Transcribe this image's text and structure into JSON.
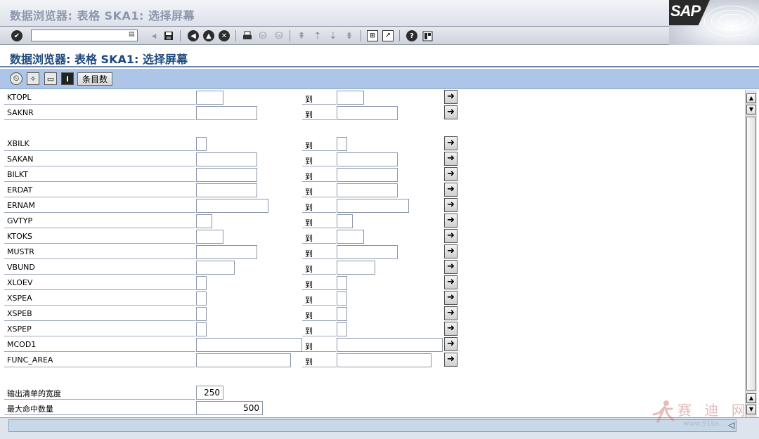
{
  "window": {
    "title": "数据浏览器: 表格 SKA1: 选择屏幕"
  },
  "brand": {
    "logo_text": "SAP",
    "colors": {
      "screen_title": "#1e4a7e",
      "app_toolbar": "#adc5e6",
      "header_bg": "#dde1ea"
    }
  },
  "toolbar": {
    "command_field": {
      "value": "",
      "placeholder": ""
    },
    "icons": [
      "enter-checkmark-icon",
      "command-history-icon",
      "save-icon",
      "back-icon",
      "exit-icon",
      "cancel-icon",
      "print-icon",
      "find-icon",
      "find-next-icon",
      "first-page-icon",
      "previous-page-icon",
      "next-page-icon",
      "last-page-icon",
      "create-session-icon",
      "create-shortcut-icon",
      "help-icon",
      "customize-layout-icon"
    ]
  },
  "screen": {
    "title": "数据浏览器: 表格 SKA1: 选择屏幕"
  },
  "app_toolbar": {
    "entries_label": "条目数",
    "icons": [
      "execute-icon",
      "get-variant-icon",
      "save-variant-icon",
      "info-icon"
    ]
  },
  "form": {
    "to_label": "到",
    "fields": [
      {
        "name": "KTOPL",
        "from": "",
        "to": ""
      },
      {
        "name": "SAKNR",
        "from": "",
        "to": ""
      },
      {
        "name": "XBILK",
        "from": "",
        "to": ""
      },
      {
        "name": "SAKAN",
        "from": "",
        "to": ""
      },
      {
        "name": "BILKT",
        "from": "",
        "to": ""
      },
      {
        "name": "ERDAT",
        "from": "",
        "to": ""
      },
      {
        "name": "ERNAM",
        "from": "",
        "to": ""
      },
      {
        "name": "GVTYP",
        "from": "",
        "to": ""
      },
      {
        "name": "KTOKS",
        "from": "",
        "to": ""
      },
      {
        "name": "MUSTR",
        "from": "",
        "to": ""
      },
      {
        "name": "VBUND",
        "from": "",
        "to": ""
      },
      {
        "name": "XLOEV",
        "from": "",
        "to": ""
      },
      {
        "name": "XSPEA",
        "from": "",
        "to": ""
      },
      {
        "name": "XSPEB",
        "from": "",
        "to": ""
      },
      {
        "name": "XSPEP",
        "from": "",
        "to": ""
      },
      {
        "name": "MCOD1",
        "from": "",
        "to": ""
      },
      {
        "name": "FUNC_AREA",
        "from": "",
        "to": ""
      }
    ],
    "output_width": {
      "label": "输出清单的宽度",
      "value": "250"
    },
    "max_hits": {
      "label": "最大命中数量",
      "value": "500"
    }
  },
  "statusbar": {
    "message": ""
  },
  "watermark": {
    "text": "赛 迪 网",
    "url": "www.91sa..."
  }
}
